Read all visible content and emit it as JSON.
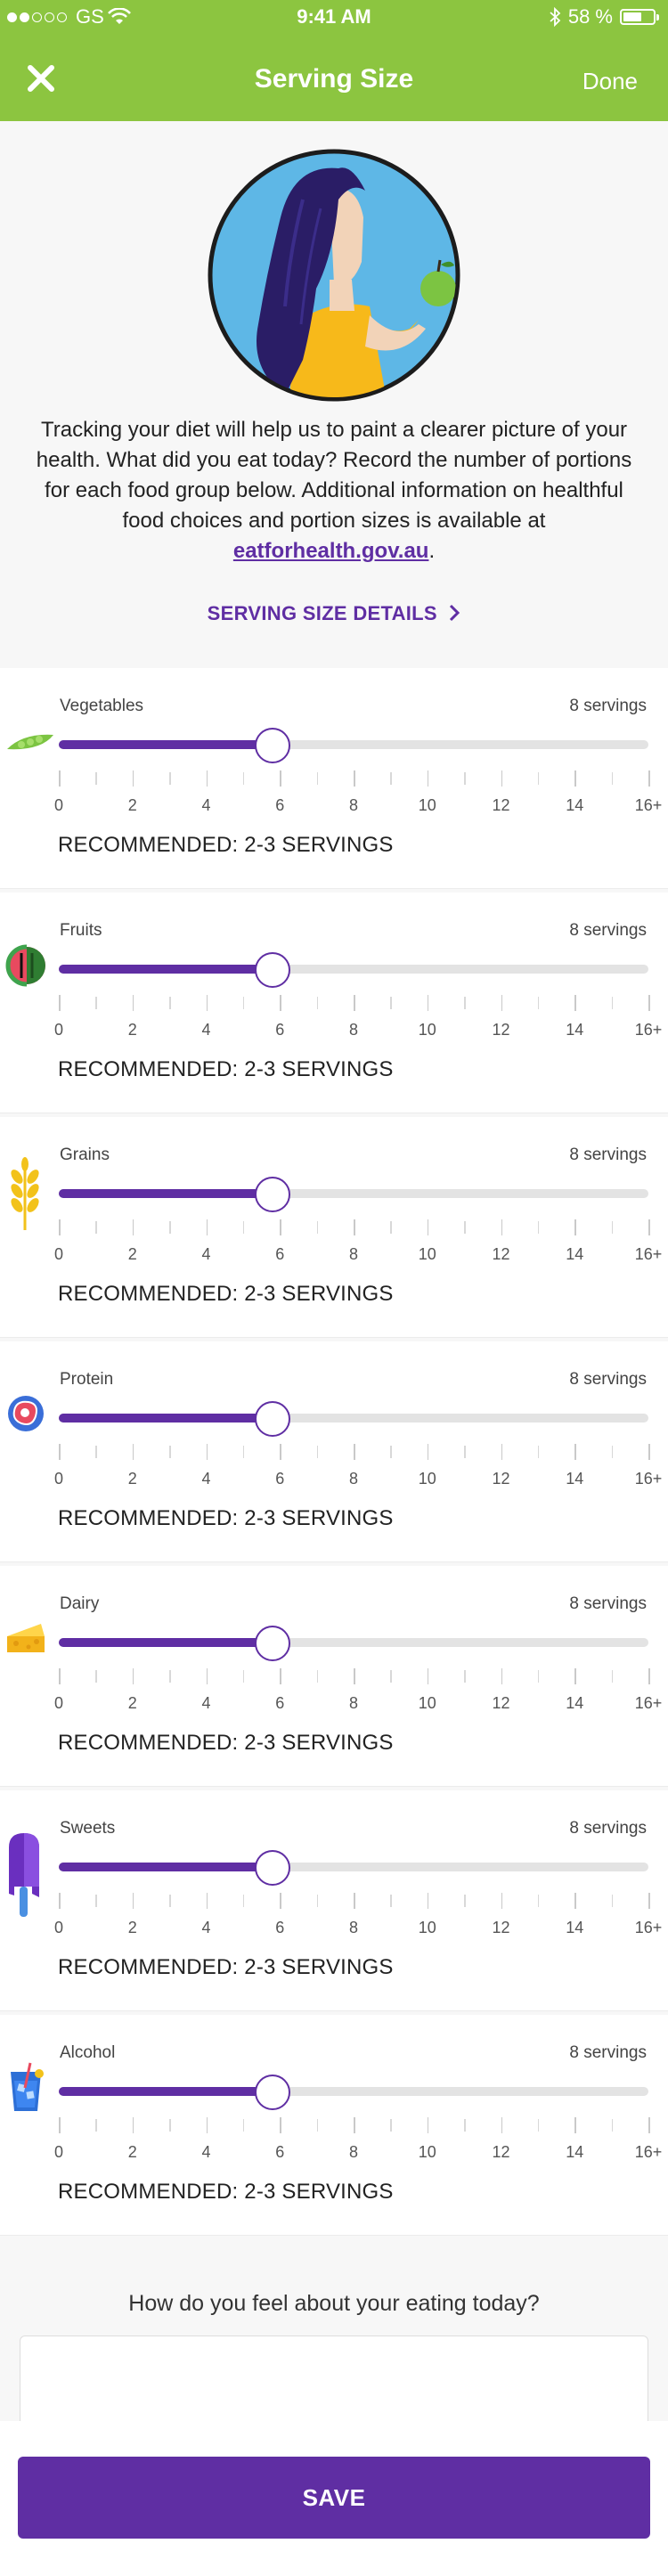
{
  "status": {
    "carrier": "GS",
    "time": "9:41 AM",
    "battery": "58 %",
    "battery_level": 0.58,
    "signal_bars": 2
  },
  "nav": {
    "title": "Serving Size",
    "done_label": "Done",
    "close_icon": "close-x-icon"
  },
  "intro": {
    "avatar_icon": "woman-holding-apple-illustration",
    "text": "Tracking your diet will help us to paint a clearer picture of your health. What did you eat today? Record the number of portions for each food group below. Additional information on healthful food choices and portion sizes is available at",
    "link_text": "eatforhealth.gov.au",
    "after_link": ".",
    "details_label": "SERVING SIZE DETAILS",
    "details_icon": "chevron-right-icon"
  },
  "slider_scale": {
    "min": 0,
    "max": 16,
    "tick_labels": [
      "0",
      "2",
      "4",
      "6",
      "8",
      "10",
      "12",
      "14",
      "16+"
    ]
  },
  "food_groups": [
    {
      "name": "Vegetables",
      "servings_text": "8 servings",
      "value": 5.8,
      "recommended": "RECOMMENDED: 2-3 SERVINGS",
      "icon": "pea-pod-icon"
    },
    {
      "name": "Fruits",
      "servings_text": "8 servings",
      "value": 5.8,
      "recommended": "RECOMMENDED: 2-3 SERVINGS",
      "icon": "watermelon-icon"
    },
    {
      "name": "Grains",
      "servings_text": "8 servings",
      "value": 5.8,
      "recommended": "RECOMMENDED: 2-3 SERVINGS",
      "icon": "wheat-icon"
    },
    {
      "name": "Protein",
      "servings_text": "8 servings",
      "value": 5.8,
      "recommended": "RECOMMENDED: 2-3 SERVINGS",
      "icon": "steak-icon"
    },
    {
      "name": "Dairy",
      "servings_text": "8 servings",
      "value": 5.8,
      "recommended": "RECOMMENDED: 2-3 SERVINGS",
      "icon": "cheese-icon"
    },
    {
      "name": "Sweets",
      "servings_text": "8 servings",
      "value": 5.8,
      "recommended": "RECOMMENDED: 2-3 SERVINGS",
      "icon": "popsicle-icon"
    },
    {
      "name": "Alcohol",
      "servings_text": "8 servings",
      "value": 5.8,
      "recommended": "RECOMMENDED: 2-3 SERVINGS",
      "icon": "cocktail-glass-icon"
    }
  ],
  "feel": {
    "question": "How do you feel about your eating today?",
    "value": ""
  },
  "save_label": "SAVE",
  "colors": {
    "brand_green": "#8cc540",
    "accent_purple": "#5f2ea3",
    "track_grey": "#e3e3e3"
  }
}
